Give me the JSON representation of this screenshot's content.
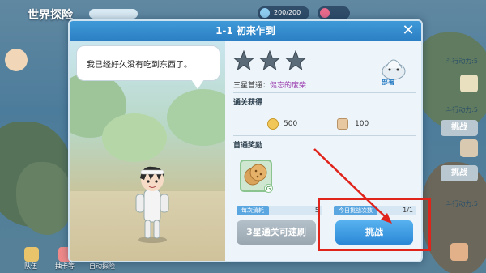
{
  "header": {
    "title": "世界探险",
    "tag": "",
    "energy": "200/200"
  },
  "dialog": {
    "title": "1-1 初来乍到",
    "close_glyph": "✕",
    "speech": "我已经好久没有吃到东西了。",
    "stars_count": 3,
    "boss_label": "部署",
    "first_clear_prefix": "三星首通：",
    "first_clear_reward": "健忘的废柴",
    "pass_section": "通关获得",
    "rewards": [
      {
        "icon": "gold-coin-icon",
        "value": "500"
      },
      {
        "icon": "bread-icon",
        "value": "100"
      }
    ],
    "first_section": "首通奖励",
    "first_item_badge": "G",
    "cost_label": "每次消耗",
    "cost_value": "5",
    "daily_label": "今日挑战次数",
    "daily_value": "1/1",
    "sweep_button": "3星通关可速刷",
    "challenge_button": "挑战"
  },
  "side": {
    "labels": [
      "斗行动力:5",
      "斗行动力:5",
      "斗行动力:5"
    ],
    "challenge_label": "挑战"
  },
  "bottom_nav": [
    "队伍",
    "抽卡等",
    "自动探险"
  ],
  "colors": {
    "accent_blue": "#2c7fc4",
    "highlight_red": "#e0241c",
    "purple_text": "#9b3fb0"
  }
}
